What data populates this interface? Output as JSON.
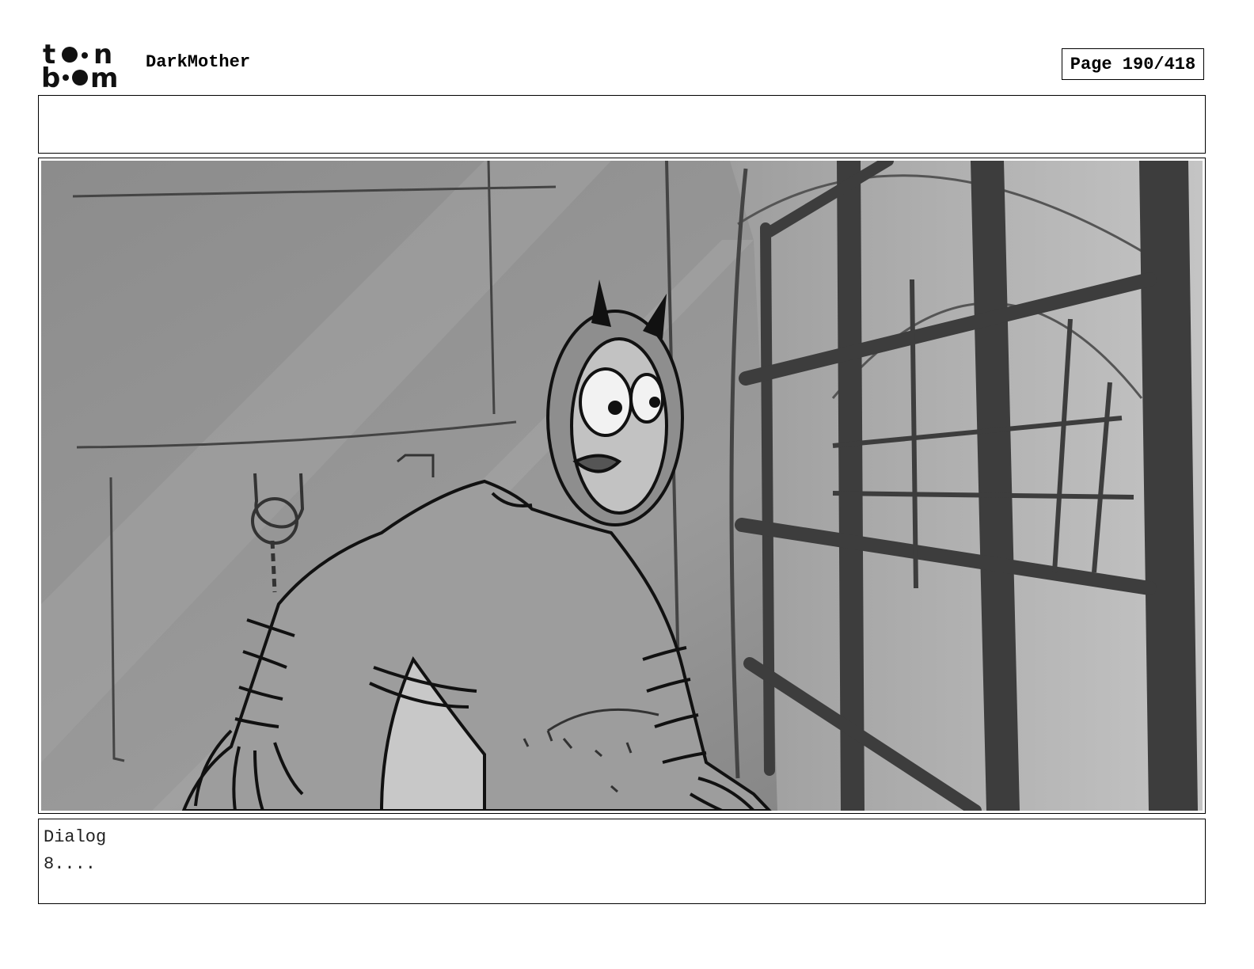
{
  "header": {
    "logo_top_text": "toon",
    "logo_bottom_text": "boom",
    "project_title": "DarkMother",
    "page_indicator": "Page 190/418"
  },
  "panel": {
    "notes_text": "",
    "image_subject": "storyboard-sketch-horned-character-at-window-bars"
  },
  "dialog": {
    "label": "Dialog",
    "text": "8...."
  }
}
